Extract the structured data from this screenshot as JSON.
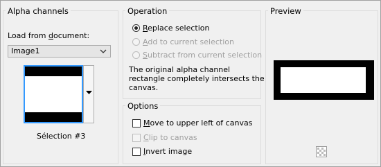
{
  "alpha_channels": {
    "title": "Alpha channels",
    "load_label": "Load from document:",
    "document_value": "Image1",
    "thumbnail_caption": "Sélection #3"
  },
  "operation": {
    "title": "Operation",
    "replace_label": "Replace selection",
    "add_label": "Add to current selection",
    "subtract_label": "Subtract from current selection",
    "info_line1": "The original alpha channel",
    "info_line2": "rectangle completely intersects the",
    "info_line3": "canvas."
  },
  "options": {
    "title": "Options",
    "move_label": "Move to upper left of canvas",
    "clip_label": "Clip to canvas",
    "invert_label": "Invert image"
  },
  "preview": {
    "title": "Preview"
  },
  "icons": {
    "combo_arrow": "chevron-down-icon",
    "thumb_arrow": "triangle-down-icon",
    "preview_bg": "checkerboard-icon"
  },
  "colors": {
    "accent": "#3399ff",
    "disabled_text": "#a0a0a0"
  }
}
